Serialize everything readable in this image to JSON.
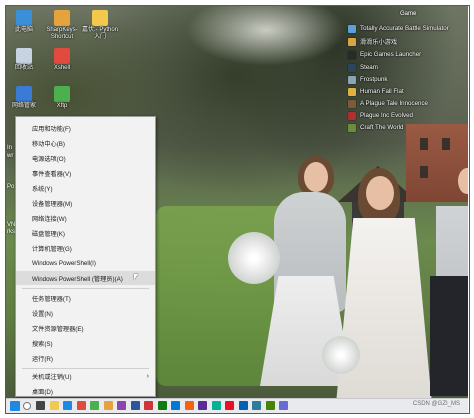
{
  "desktop_icons": [
    {
      "label": "此电脑",
      "icon": "computer-icon",
      "color": "#3b8fd9"
    },
    {
      "label": "回收站",
      "icon": "recycle-bin-icon",
      "color": "#c7d3e0"
    },
    {
      "label": "网络管家",
      "icon": "network-icon",
      "color": "#3a7bd5"
    },
    {
      "label": "SharpKeys-Shortcut",
      "icon": "keyboard-icon",
      "color": "#e6a23c"
    },
    {
      "label": "Xshell",
      "icon": "xshell-icon",
      "color": "#e04a3f"
    },
    {
      "label": "Xftp",
      "icon": "xftp-icon",
      "color": "#4caf50"
    },
    {
      "label": "嘉伏:- Python入门",
      "icon": "folder-icon",
      "color": "#f2c94c"
    }
  ],
  "edge_labels": [
    "In",
    "wr",
    "Po",
    "VN",
    "rks"
  ],
  "game_shortcuts": [
    {
      "label": "Totally Accurate Battle Simulator",
      "icon": "steam-game-icon",
      "color": "#5ea0d6"
    },
    {
      "label": "滑滑乐小游戏",
      "icon": "steam-game-icon",
      "color": "#d9a441"
    },
    {
      "label": "Epic Games Launcher",
      "icon": "epic-games-icon",
      "color": "#2a2a2a"
    },
    {
      "label": "Steam",
      "icon": "steam-icon",
      "color": "#2a475e"
    },
    {
      "label": "Frostpunk",
      "icon": "steam-game-icon",
      "color": "#8aa5b8"
    },
    {
      "label": "Human Fall Flat",
      "icon": "steam-game-icon",
      "color": "#e0b040"
    },
    {
      "label": "A Plague Tale Innocence",
      "icon": "steam-game-icon",
      "color": "#7a5b3a"
    },
    {
      "label": "Plague Inc Evolved",
      "icon": "steam-game-icon",
      "color": "#b03030"
    },
    {
      "label": "Craft The World",
      "icon": "steam-game-icon",
      "color": "#6b8e3a"
    }
  ],
  "game_header": "Game",
  "winx_menu": {
    "items": [
      {
        "label": "应用和功能(F)",
        "highlighted": false
      },
      {
        "label": "移动中心(B)",
        "highlighted": false
      },
      {
        "label": "电源选项(O)",
        "highlighted": false
      },
      {
        "label": "事件查看器(V)",
        "highlighted": false
      },
      {
        "label": "系统(Y)",
        "highlighted": false
      },
      {
        "label": "设备管理器(M)",
        "highlighted": false
      },
      {
        "label": "网络连接(W)",
        "highlighted": false
      },
      {
        "label": "磁盘管理(K)",
        "highlighted": false
      },
      {
        "label": "计算机管理(G)",
        "highlighted": false
      },
      {
        "label": "Windows PowerShell(I)",
        "highlighted": false
      },
      {
        "label": "Windows PowerShell (管理员)(A)",
        "highlighted": true
      },
      {
        "label": "任务管理器(T)",
        "highlighted": false
      },
      {
        "label": "设置(N)",
        "highlighted": false
      },
      {
        "label": "文件资源管理器(E)",
        "highlighted": false
      },
      {
        "label": "搜索(S)",
        "highlighted": false
      },
      {
        "label": "运行(R)",
        "highlighted": false
      },
      {
        "label": "关机或注销(U)",
        "highlighted": false,
        "submenu": true
      },
      {
        "label": "桌面(D)",
        "highlighted": false
      }
    ],
    "submenu_arrow": "›"
  },
  "taskbar": {
    "items": [
      {
        "icon": "start-icon",
        "color": "#1e88e5"
      },
      {
        "icon": "search-icon",
        "color": "#ffffff"
      },
      {
        "icon": "task-view-icon",
        "color": "#444444"
      },
      {
        "icon": "file-explorer-icon",
        "color": "#f2c94c"
      },
      {
        "icon": "edge-icon",
        "color": "#1e88e5"
      },
      {
        "icon": "app-icon",
        "color": "#e04a3f"
      },
      {
        "icon": "app-icon",
        "color": "#4caf50"
      },
      {
        "icon": "app-icon",
        "color": "#e6a23c"
      },
      {
        "icon": "app-icon",
        "color": "#8e44ad"
      },
      {
        "icon": "app-icon",
        "color": "#2b579a"
      },
      {
        "icon": "app-icon",
        "color": "#d13438"
      },
      {
        "icon": "app-icon",
        "color": "#107c10"
      },
      {
        "icon": "app-icon",
        "color": "#0078d4"
      },
      {
        "icon": "app-icon",
        "color": "#f7630c"
      },
      {
        "icon": "app-icon",
        "color": "#5c2d91"
      },
      {
        "icon": "app-icon",
        "color": "#00b294"
      },
      {
        "icon": "app-icon",
        "color": "#e81123"
      },
      {
        "icon": "app-icon",
        "color": "#0063b1"
      },
      {
        "icon": "app-icon",
        "color": "#2d7d9a"
      },
      {
        "icon": "app-icon",
        "color": "#498205"
      },
      {
        "icon": "app-icon",
        "color": "#6b69d6"
      }
    ],
    "watermark": "CSDN @GZI_MS"
  }
}
